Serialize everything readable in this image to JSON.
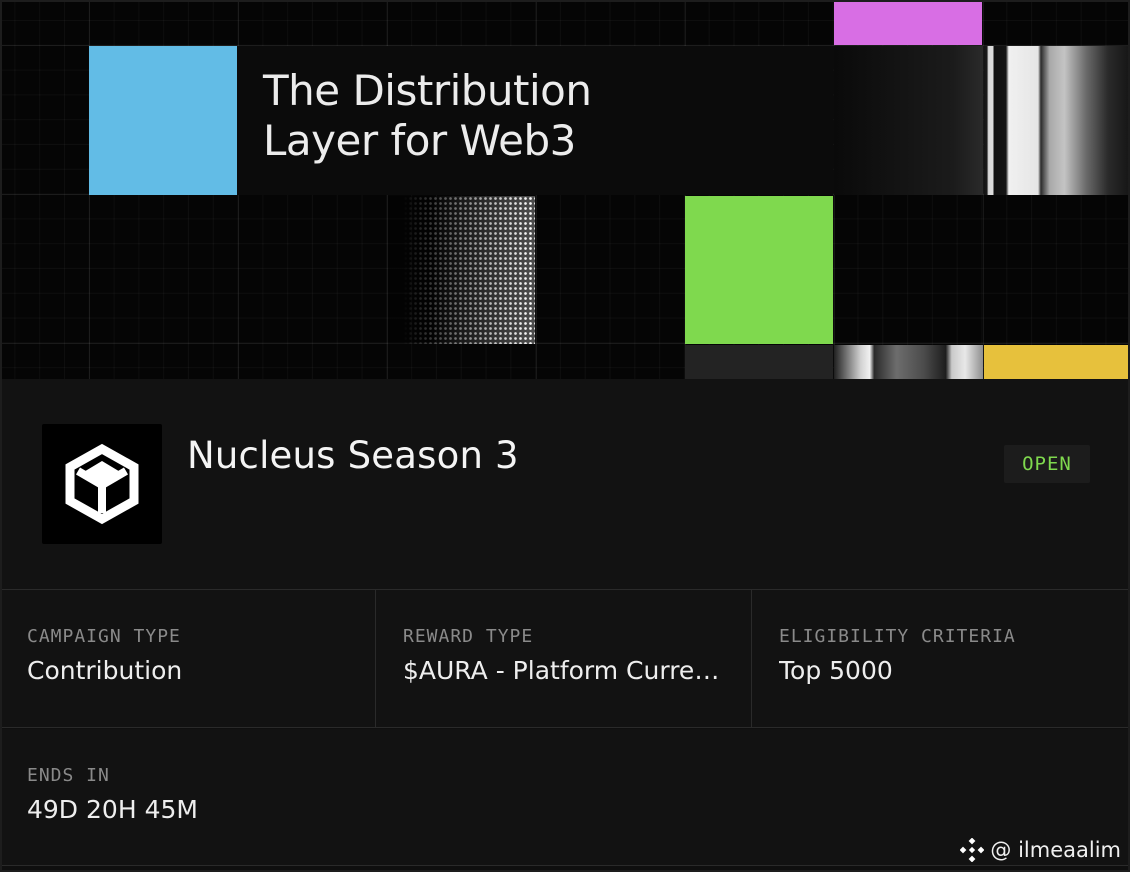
{
  "hero": {
    "title_line1": "The Distribution",
    "title_line2": "Layer for Web3",
    "accent_colors": {
      "blue": "#62bce6",
      "pink": "#d86ee4",
      "green": "#7fd94e",
      "yellow": "#e7c13c"
    }
  },
  "campaign": {
    "name": "Nucleus Season 3",
    "logo_icon": "nucleus-cube-icon",
    "status": "OPEN",
    "status_color": "#7fd94e"
  },
  "details": [
    {
      "label": "CAMPAIGN TYPE",
      "value": "Contribution"
    },
    {
      "label": "REWARD TYPE",
      "value": "$AURA - Platform Currency"
    },
    {
      "label": "ELIGIBILITY CRITERIA",
      "value": "Top 5000"
    }
  ],
  "ends": {
    "label": "ENDS IN",
    "value": "49D 20H 45M"
  },
  "watermark": {
    "icon": "binance-logo-icon",
    "handle": "@ ilmeaalim"
  }
}
